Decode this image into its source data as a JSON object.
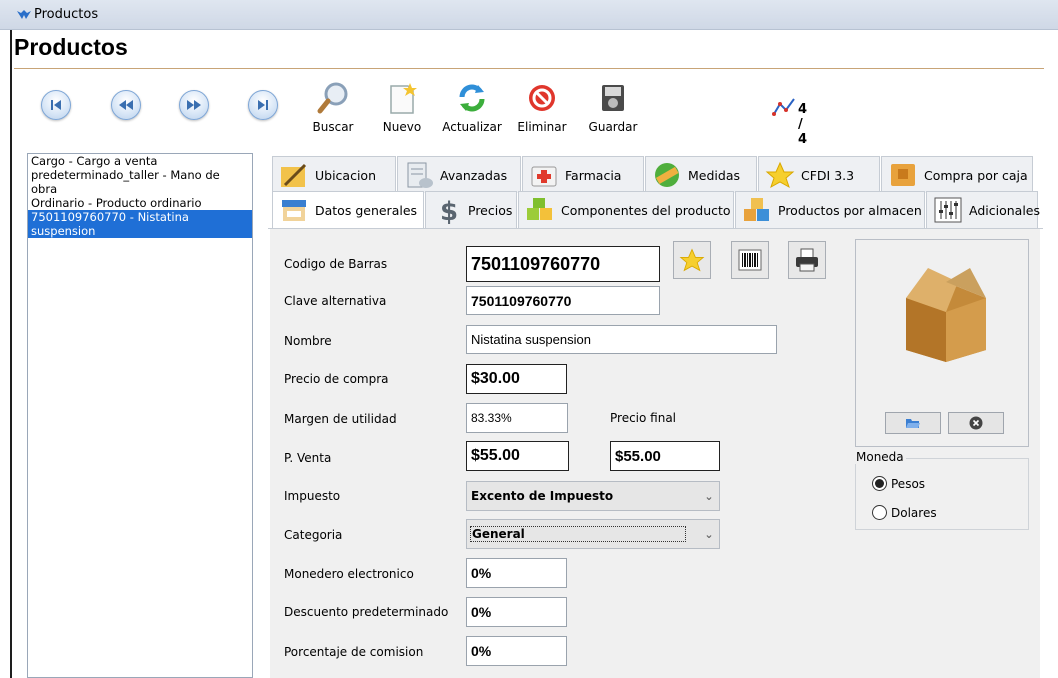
{
  "window": {
    "title": "Productos"
  },
  "page": {
    "title": "Productos"
  },
  "toolbar": {
    "buttons": [
      {
        "label": "Buscar",
        "icon": "search-icon"
      },
      {
        "label": "Nuevo",
        "icon": "new-icon"
      },
      {
        "label": "Actualizar",
        "icon": "refresh-icon"
      },
      {
        "label": "Eliminar",
        "icon": "delete-icon"
      },
      {
        "label": "Guardar",
        "icon": "save-icon"
      }
    ],
    "nav": [
      "first-icon",
      "previous-icon",
      "next-icon",
      "last-icon"
    ],
    "counter": "4 / 4"
  },
  "records": [
    "Cargo - Cargo a venta predeterminado_taller - Mano de obra",
    "Ordinario - Producto ordinario",
    "7501109760770 - Nistatina suspension"
  ],
  "tabs": {
    "row1": [
      "Ubicacion",
      "Avanzadas",
      "Farmacia",
      "Medidas",
      "CFDI 3.3",
      "Compra por caja"
    ],
    "row2": [
      "Datos generales",
      "Precios",
      "Componentes del producto",
      "Productos por almacen",
      "Adicionales"
    ]
  },
  "form": {
    "labels": {
      "codigo": "Codigo de Barras",
      "clave": "Clave alternativa",
      "nombre": "Nombre",
      "precio_compra": "Precio de compra",
      "margen": "Margen de utilidad",
      "precio_final": "Precio final",
      "pventa": "P. Venta",
      "impuesto": "Impuesto",
      "categoria": "Categoria",
      "monedero": "Monedero electronico",
      "descuento": "Descuento predeterminado",
      "comision": "Porcentaje de comision"
    },
    "values": {
      "codigo": "7501109760770",
      "clave": "7501109760770",
      "nombre": "Nistatina suspension",
      "precio_compra": "$30.00",
      "margen": "83.33%",
      "pventa": "$55.00",
      "precio_final": "$55.00",
      "impuesto": "Excento de Impuesto",
      "categoria": "General",
      "monedero": "0%",
      "descuento": "0%",
      "comision": "0%"
    }
  },
  "currency": {
    "legend": "Moneda",
    "options": [
      "Pesos",
      "Dolares"
    ],
    "selected": "Pesos"
  },
  "colors": {
    "selection": "#1f6fd6",
    "panel": "#f0f0f0"
  }
}
